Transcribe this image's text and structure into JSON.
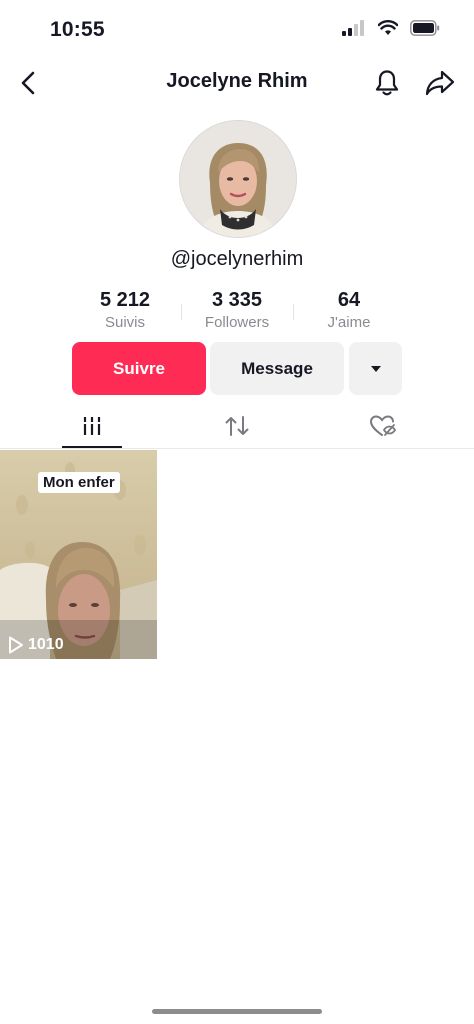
{
  "status_bar": {
    "time": "10:55"
  },
  "header": {
    "title": "Jocelyne Rhim",
    "icons": {
      "back": "chevron-left-icon",
      "notifications": "bell-icon",
      "share": "share-arrow-icon"
    }
  },
  "profile": {
    "handle": "@jocelynerhim",
    "stats": [
      {
        "value": "5 212",
        "label": "Suivis"
      },
      {
        "value": "3 335",
        "label": "Followers"
      },
      {
        "value": "64",
        "label": "J'aime"
      }
    ]
  },
  "actions": {
    "follow_label": "Suivre",
    "message_label": "Message",
    "more_icon": "caret-down-icon"
  },
  "tabs": [
    {
      "icon": "videos-grid-icon",
      "active": true
    },
    {
      "icon": "repost-icon",
      "active": false
    },
    {
      "icon": "liked-hidden-icon",
      "active": false
    }
  ],
  "videos": [
    {
      "caption": "Mon enfer",
      "views": "1010"
    }
  ],
  "colors": {
    "accent": "#fe2c55",
    "secondary_button": "#f1f1f2",
    "muted_text": "#8a8b91"
  }
}
